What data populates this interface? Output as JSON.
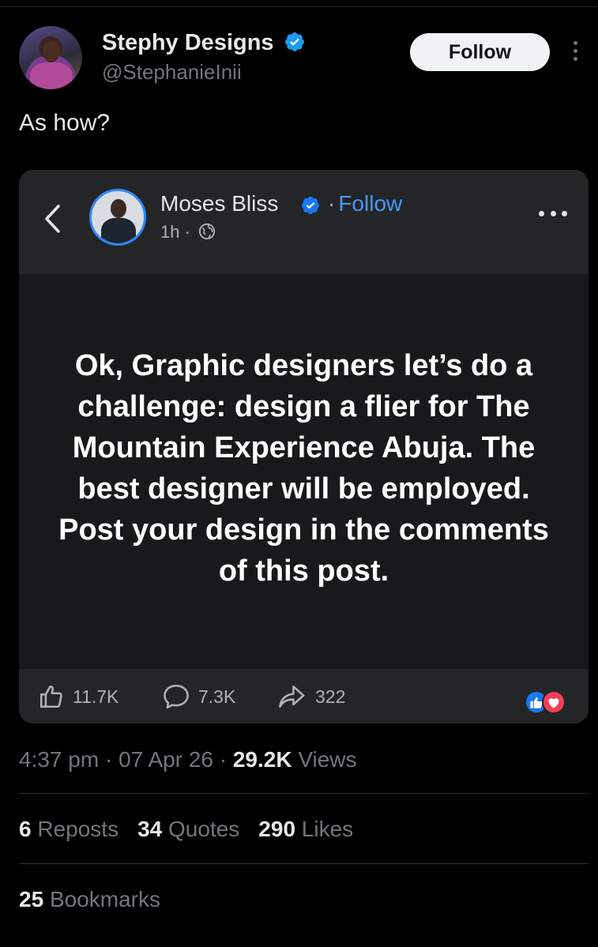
{
  "tweet": {
    "author_name": "Stephy Designs",
    "author_handle": "@StephanieInii",
    "follow_label": "Follow",
    "text": "As how?",
    "meta": {
      "time": "4:37 pm",
      "date": "07 Apr 26",
      "views_count": "29.2K",
      "views_label": "Views",
      "sep": "·"
    },
    "stats": {
      "reposts_count": "6",
      "reposts_label": "Reposts",
      "quotes_count": "34",
      "quotes_label": "Quotes",
      "likes_count": "290",
      "likes_label": "Likes",
      "bookmarks_count": "25",
      "bookmarks_label": "Bookmarks"
    }
  },
  "embedded_post": {
    "author_name": "Moses Bliss",
    "follow_label": "Follow",
    "follow_sep": "·",
    "time": "1h",
    "time_sep": "·",
    "text": "Ok, Graphic designers let’s do a challenge: design a flier for The Mountain  Experience Abuja. The best designer will be employed. Post your design in the comments of this post.",
    "likes": "11.7K",
    "comments": "7.3K",
    "shares": "322"
  },
  "colors": {
    "background": "#000000",
    "verified_blue": "#1d9bf0",
    "fb_link_blue": "#4599ff",
    "card_bg": "#242526",
    "card_body_bg": "#18191a"
  },
  "icons": [
    "verified-badge-icon",
    "more-vertical-icon",
    "back-chevron-icon",
    "globe-icon",
    "more-horizontal-icon",
    "thumbs-up-icon",
    "comment-icon",
    "share-icon",
    "like-reaction-icon",
    "love-reaction-icon"
  ]
}
